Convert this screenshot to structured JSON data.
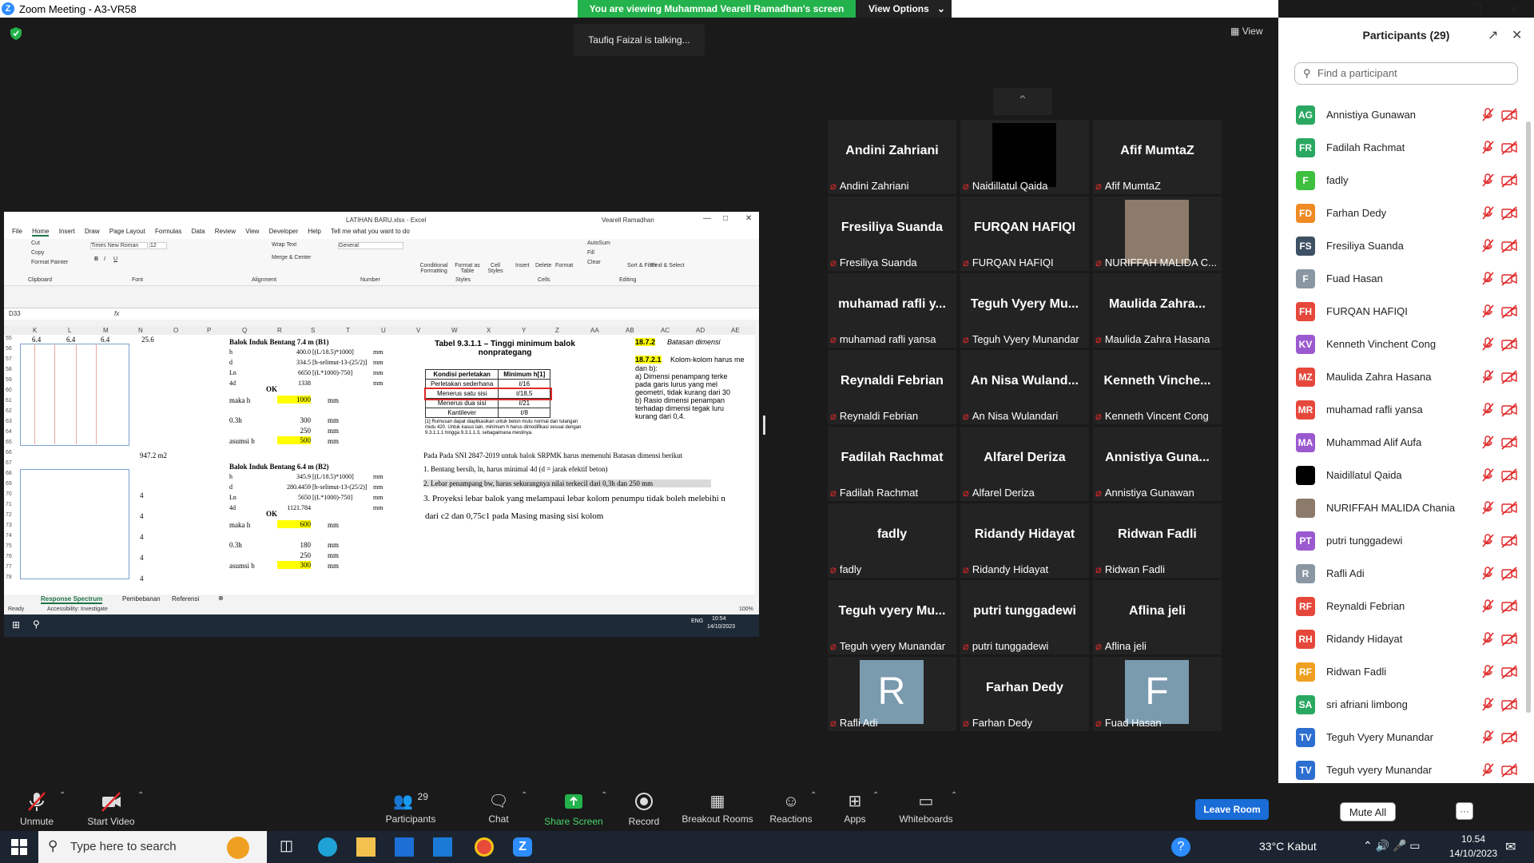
{
  "window": {
    "title": "Zoom Meeting - A3-VR58",
    "banner": "You are viewing Muhammad Vearell Ramadhan's screen",
    "view_options": "View Options",
    "talking": "Taufiq Faizal is talking...",
    "view_label": "View"
  },
  "excel": {
    "title": "LATIHAN BARU.xlsx  -  Excel",
    "user": "Vearell Ramadhan",
    "menu": [
      "File",
      "Home",
      "Insert",
      "Draw",
      "Page Layout",
      "Formulas",
      "Data",
      "Review",
      "View",
      "Developer",
      "Help",
      "Tell me what you want to do"
    ],
    "ribbon": {
      "clipboard": [
        "Cut",
        "Copy",
        "Format Painter",
        "Clipboard"
      ],
      "font_name": "Times New Roman",
      "font_size": "12",
      "font_group": "Font",
      "wrap": "Wrap Text",
      "merge": "Merge & Center",
      "alignment": "Alignment",
      "number_format": "General",
      "number": "Number",
      "styles": [
        "Conditional Formatting",
        "Format as Table",
        "Cell Styles",
        "Styles"
      ],
      "cells": [
        "Insert",
        "Delete",
        "Format",
        "Cells"
      ],
      "editing": [
        "AutoSum",
        "Fill",
        "Clear",
        "Sort & Filter",
        "Find & Select",
        "Editing"
      ]
    },
    "name_box": "D33",
    "fx": "fx",
    "columns": [
      "K",
      "L",
      "M",
      "N",
      "O",
      "P",
      "Q",
      "R",
      "S",
      "T",
      "U",
      "V",
      "W",
      "X",
      "Y",
      "Z",
      "AA",
      "AB",
      "AC",
      "AD",
      "AE"
    ],
    "rows": [
      "55",
      "56",
      "57",
      "58",
      "59",
      "60",
      "61",
      "62",
      "63",
      "64",
      "65",
      "66",
      "67",
      "68",
      "69",
      "70",
      "71",
      "72",
      "73",
      "74",
      "75",
      "76",
      "77",
      "78"
    ],
    "row55": [
      "6.4",
      "6.4",
      "6.4",
      "25.6"
    ],
    "area": "947.2 m2",
    "fours": [
      "4",
      "4",
      "4",
      "4",
      "4"
    ],
    "b1": {
      "title": "Balok Induk Bentang 7.4 m (B1)",
      "lines": [
        {
          "k": "h",
          "v": "400.0",
          "f": "[(L/18.5)*1000]",
          "u": "mm"
        },
        {
          "k": "d",
          "v": "334.5",
          "f": "[h-selimut-13-(25/2)]",
          "u": "mm"
        },
        {
          "k": "Ln",
          "v": "6650",
          "f": "[(L*1000)-750]",
          "u": "mm"
        },
        {
          "k": "4d",
          "v": "1338",
          "f": "",
          "u": "mm"
        }
      ],
      "ok": "OK",
      "maka_h": "maka h",
      "maka_v": "1000",
      "l03": "0.3h",
      "v300": "300",
      "v250": "250",
      "asumsi": "asumsi b",
      "asumsi_v": "500",
      "mm": "mm"
    },
    "b2": {
      "title": "Balok Induk Bentang 6.4 m (B2)",
      "lines": [
        {
          "k": "h",
          "v": "345.9",
          "f": "[(L/18.5)*1000]",
          "u": "mm"
        },
        {
          "k": "d",
          "v": "280.4459",
          "f": "[h-selimut-13-(25/2)]",
          "u": "mm"
        },
        {
          "k": "Ln",
          "v": "5650",
          "f": "[(L*1000)-750]",
          "u": "mm"
        },
        {
          "k": "4d",
          "v": "1121.784",
          "f": "",
          "u": "mm"
        }
      ],
      "ok": "OK",
      "maka_h": "maka h",
      "maka_v": "600",
      "l03": "0.3h",
      "v180": "180",
      "v250": "250",
      "asumsi": "asumsi b",
      "asumsi_v": "300",
      "mm": "mm"
    },
    "table_title": "Tabel 9.3.1.1 – Tinggi minimum balok nonprategang",
    "table_headers": [
      "Kondisi perletakan",
      "Minimum h[1]"
    ],
    "table_rows": [
      [
        "Perletakan sederhana",
        "ℓ/16"
      ],
      [
        "Menerus satu sisi",
        "ℓ/18,5"
      ],
      [
        "Menerus dua sisi",
        "ℓ/21"
      ],
      [
        "Kantilever",
        "ℓ/8"
      ]
    ],
    "table_note": "[1] Rumusan dapat diaplikasikan untuk beton mutu normal dan tulangan mutu 420. Untuk kasus lain, minimum h harus dimodifikasi sesuai dengan 9.3.1.1.1 hingga 9.3.1.1.3, sebagaimana mestinya.",
    "right_ref1": "18.7.2",
    "right_ref1_text": "Batasan dimensi",
    "right_ref2": "18.7.2.1",
    "right_ref2_text": "Kolom-kolom harus me",
    "right_lines": [
      "dan b):",
      "a) Dimensi penampang terke",
      "pada garis lurus yang mel",
      "geometri, tidak kurang dari 30",
      "b) Rasio dimensi penampan",
      "terhadap dimensi tegak luru",
      "kurang dari 0,4."
    ],
    "sni": "Pada Pada SNI 2847-2019 untuk balok SRPMK harus memenuhi Batasan dimensi berikut",
    "item1": "1.    Bentang bersih, ln, harus minimal 4d (d = jarak efektif beton)",
    "item2": "2.    Lebar penampang bw, harus sekurangnya nilai terkecil dari 0,3h dan 250 mm",
    "item3": "3.   Proyeksi lebar balok yang melampaui lebar kolom penumpu tidak boleh melebihi n",
    "item3b": "dari c2 dan 0,75c1 pada Masing masing sisi kolom",
    "tabs": [
      "Response Spectrum",
      "Pembebanan",
      "Referensi"
    ],
    "status": [
      "Ready",
      "Accessibility: Investigate"
    ],
    "zoom": "100%",
    "tb_lang": "ENG",
    "tb_time": "10:54",
    "tb_date": "14/10/2023"
  },
  "tiles": [
    {
      "big": "Andini Zahriani",
      "label": "Andini Zahriani",
      "type": "name"
    },
    {
      "big": "",
      "label": "Naidillatul Qaida",
      "type": "black"
    },
    {
      "big": "Afif MumtaZ",
      "label": "Afif MumtaZ",
      "type": "name"
    },
    {
      "big": "Fresiliya Suanda",
      "label": "Fresiliya Suanda",
      "type": "name"
    },
    {
      "big": "FURQAN HAFIQI",
      "label": "FURQAN HAFIQI",
      "type": "name"
    },
    {
      "big": "",
      "label": "NURIFFAH MALIDA C...",
      "type": "photo"
    },
    {
      "big": "muhamad rafli y...",
      "label": "muhamad rafli yansa",
      "type": "name"
    },
    {
      "big": "Teguh Vyery Mu...",
      "label": "Teguh Vyery Munandar",
      "type": "name"
    },
    {
      "big": "Maulida Zahra...",
      "label": "Maulida Zahra Hasana",
      "type": "name"
    },
    {
      "big": "Reynaldi Febrian",
      "label": "Reynaldi Febrian",
      "type": "name"
    },
    {
      "big": "An Nisa Wuland...",
      "label": "An Nisa Wulandari",
      "type": "name"
    },
    {
      "big": "Kenneth Vinche...",
      "label": "Kenneth Vincent Cong",
      "type": "name"
    },
    {
      "big": "Fadilah Rachmat",
      "label": "Fadilah Rachmat",
      "type": "name"
    },
    {
      "big": "Alfarel Deriza",
      "label": "Alfarel Deriza",
      "type": "name"
    },
    {
      "big": "Annistiya Guna...",
      "label": "Annistiya Gunawan",
      "type": "name"
    },
    {
      "big": "fadly",
      "label": "fadly",
      "type": "name"
    },
    {
      "big": "Ridandy Hidayat",
      "label": "Ridandy Hidayat",
      "type": "name"
    },
    {
      "big": "Ridwan Fadli",
      "label": "Ridwan Fadli",
      "type": "name"
    },
    {
      "big": "Teguh vyery Mu...",
      "label": "Teguh vyery Munandar",
      "type": "name"
    },
    {
      "big": "putri tunggadewi",
      "label": "putri tunggadewi",
      "type": "name"
    },
    {
      "big": "Aflina jeli",
      "label": "Aflina jeli",
      "type": "name"
    },
    {
      "big": "R",
      "label": "Rafli Adi",
      "type": "avatar"
    },
    {
      "big": "Farhan Dedy",
      "label": "Farhan Dedy",
      "type": "name"
    },
    {
      "big": "F",
      "label": "Fuad Hasan",
      "type": "avatar"
    }
  ],
  "panel": {
    "title": "Participants (29)",
    "search_placeholder": "Find a participant",
    "mute_all": "Mute All",
    "more": "···",
    "people": [
      {
        "initials": "AG",
        "name": "Annistiya Gunawan",
        "color": "#2aa861"
      },
      {
        "initials": "FR",
        "name": "Fadilah Rachmat",
        "color": "#2aa861"
      },
      {
        "initials": "F",
        "name": "fadly",
        "color": "#3fbf3f"
      },
      {
        "initials": "FD",
        "name": "Farhan Dedy",
        "color": "#f08a24"
      },
      {
        "initials": "FS",
        "name": "Fresiliya Suanda",
        "color": "#3e5063"
      },
      {
        "initials": "F",
        "name": "Fuad Hasan",
        "color": "#8a97a3"
      },
      {
        "initials": "FH",
        "name": "FURQAN HAFIQI",
        "color": "#e5483b"
      },
      {
        "initials": "KV",
        "name": "Kenneth Vinchent Cong",
        "color": "#9b59d0"
      },
      {
        "initials": "MZ",
        "name": "Maulida Zahra Hasana",
        "color": "#e5483b"
      },
      {
        "initials": "MR",
        "name": "muhamad rafli yansa",
        "color": "#e5483b"
      },
      {
        "initials": "MA",
        "name": "Muhammad Alif Aufa",
        "color": "#9b59d0"
      },
      {
        "initials": "",
        "name": "Naidillatul Qaida",
        "color": "#000000"
      },
      {
        "initials": "",
        "name": "NURIFFAH MALIDA Chania",
        "color": "#8c7b6a"
      },
      {
        "initials": "PT",
        "name": "putri tunggadewi",
        "color": "#9b59d0"
      },
      {
        "initials": "R",
        "name": "Rafli Adi",
        "color": "#8a97a3"
      },
      {
        "initials": "RF",
        "name": "Reynaldi Febrian",
        "color": "#e5483b"
      },
      {
        "initials": "RH",
        "name": "Ridandy Hidayat",
        "color": "#e5483b"
      },
      {
        "initials": "RF",
        "name": "Ridwan Fadli",
        "color": "#f0a020"
      },
      {
        "initials": "SA",
        "name": "sri afriani limbong",
        "color": "#2aa861"
      },
      {
        "initials": "TV",
        "name": "Teguh Vyery Munandar",
        "color": "#2d6fd0"
      },
      {
        "initials": "TV",
        "name": "Teguh vyery Munandar",
        "color": "#2d6fd0"
      }
    ]
  },
  "controls": {
    "unmute": "Unmute",
    "start_video": "Start Video",
    "participants": "Participants",
    "participants_count": "29",
    "chat": "Chat",
    "share": "Share Screen",
    "record": "Record",
    "breakout": "Breakout Rooms",
    "reactions": "Reactions",
    "apps": "Apps",
    "whiteboards": "Whiteboards",
    "leave": "Leave Room"
  },
  "taskbar": {
    "search_placeholder": "Type here to search",
    "weather": "33°C  Kabut",
    "time": "10.54",
    "date": "14/10/2023"
  },
  "colors": {
    "zoom_green": "#23b24b",
    "zoom_blue": "#1a6cd6",
    "muted_red": "#e02828",
    "highlight_yellow": "#ffff00"
  }
}
